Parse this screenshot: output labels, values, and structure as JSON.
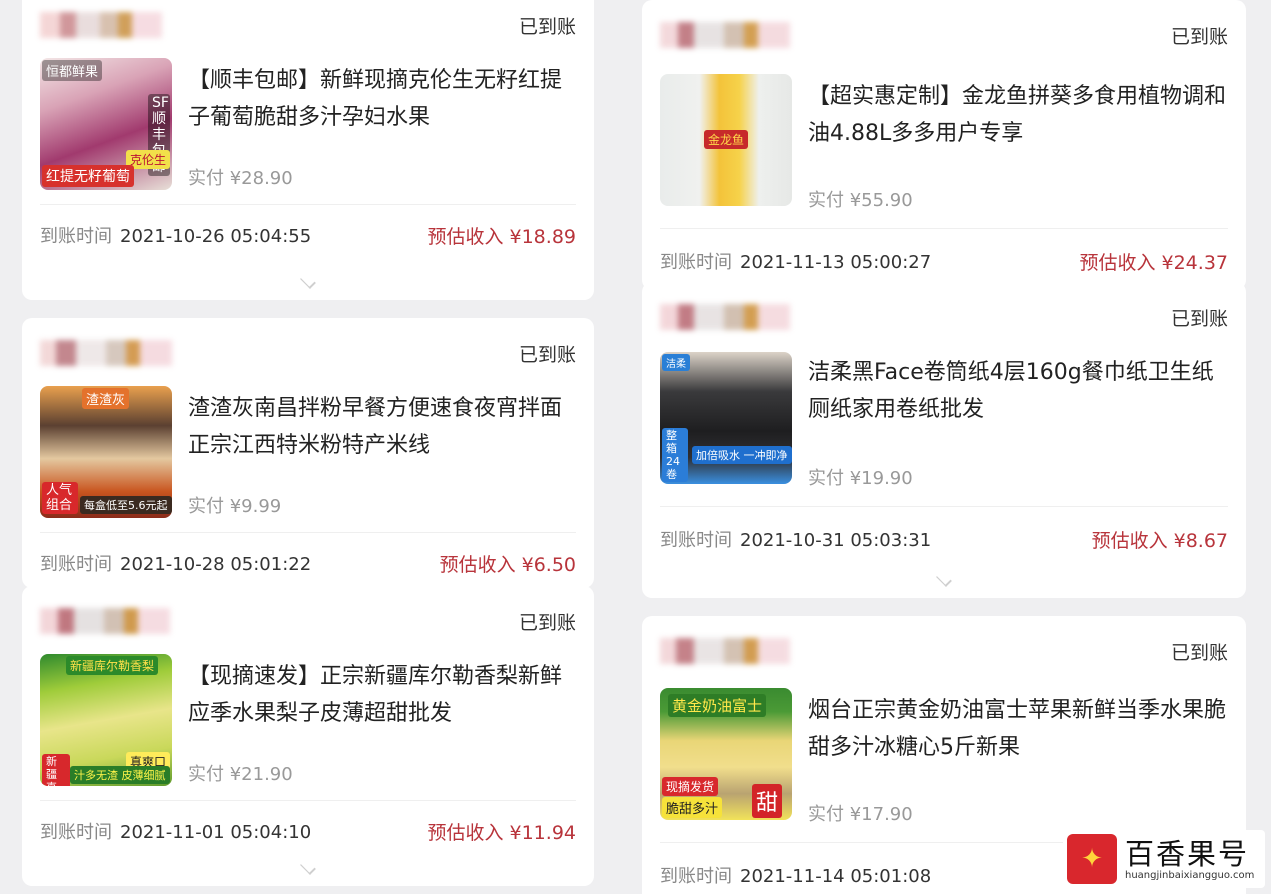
{
  "orders_left": [
    {
      "status": "已到账",
      "title": "【顺丰包邮】新鲜现摘克伦生无籽红提子葡萄脆甜多汁孕妇水果",
      "paid": "实付 ¥28.90",
      "time_label": "到账时间",
      "time": "2021-10-26 05:04:55",
      "income": "预估收入 ¥18.89",
      "thumb": {
        "top_tag": "恒都鲜果",
        "side_tag": "SF顺丰包邮",
        "badge": "克伦生",
        "banner": "红提无籽葡萄"
      }
    },
    {
      "status": "已到账",
      "title": "渣渣灰南昌拌粉早餐方便速食夜宵拌面正宗江西特米粉特产米线",
      "paid": "实付 ¥9.99",
      "time_label": "到账时间",
      "time": "2021-10-28 05:01:22",
      "income": "预估收入 ¥6.50",
      "thumb": {
        "top_tag": "渣渣灰",
        "side_tag": "人气组合",
        "badge": "每盒低至5.6元起",
        "banner": ""
      }
    },
    {
      "status": "已到账",
      "title": "【现摘速发】正宗新疆库尔勒香梨新鲜应季水果梨子皮薄超甜批发",
      "paid": "实付 ¥21.90",
      "time_label": "到账时间",
      "time": "2021-11-01 05:04:10",
      "income": "预估收入 ¥11.94",
      "thumb": {
        "top_tag": "新疆库尔勒香梨",
        "side_tag": "新疆直供",
        "badge": "真爽口",
        "banner": "汁多无渣 皮薄细腻"
      }
    }
  ],
  "orders_right": [
    {
      "status": "已到账",
      "title": "【超实惠定制】金龙鱼拼葵多食用植物调和油4.88L多多用户专享",
      "paid": "实付 ¥55.90",
      "time_label": "到账时间",
      "time": "2021-11-13 05:00:27",
      "income": "预估收入 ¥24.37",
      "thumb": {
        "top_tag": "金龙鱼",
        "side_tag": "",
        "badge": "",
        "banner": ""
      }
    },
    {
      "status": "已到账",
      "title": "洁柔黑Face卷筒纸4层160g餐巾纸卫生纸厕纸家用卷纸批发",
      "paid": "实付 ¥19.90",
      "time_label": "到账时间",
      "time": "2021-10-31 05:03:31",
      "income": "预估收入 ¥8.67",
      "thumb": {
        "top_tag": "洁柔",
        "side_tag": "整箱24卷",
        "badge": "",
        "banner": "加倍吸水 一冲即净"
      }
    },
    {
      "status": "已到账",
      "title": "烟台正宗黄金奶油富士苹果新鲜当季水果脆甜多汁冰糖心5斤新果",
      "paid": "实付 ¥17.90",
      "time_label": "到账时间",
      "time": "2021-11-14 05:01:08",
      "income": "",
      "thumb": {
        "top_tag": "黄金奶油富士",
        "side_tag": "现摘发货",
        "badge": "甜",
        "banner": "脆甜多汁"
      }
    }
  ],
  "watermark": {
    "name": "百香果号",
    "url": "huangjinbaixiangguo.com"
  },
  "colors": {
    "background": "#efeff1",
    "card": "#ffffff",
    "income": "#b8343b",
    "muted": "#999999"
  }
}
